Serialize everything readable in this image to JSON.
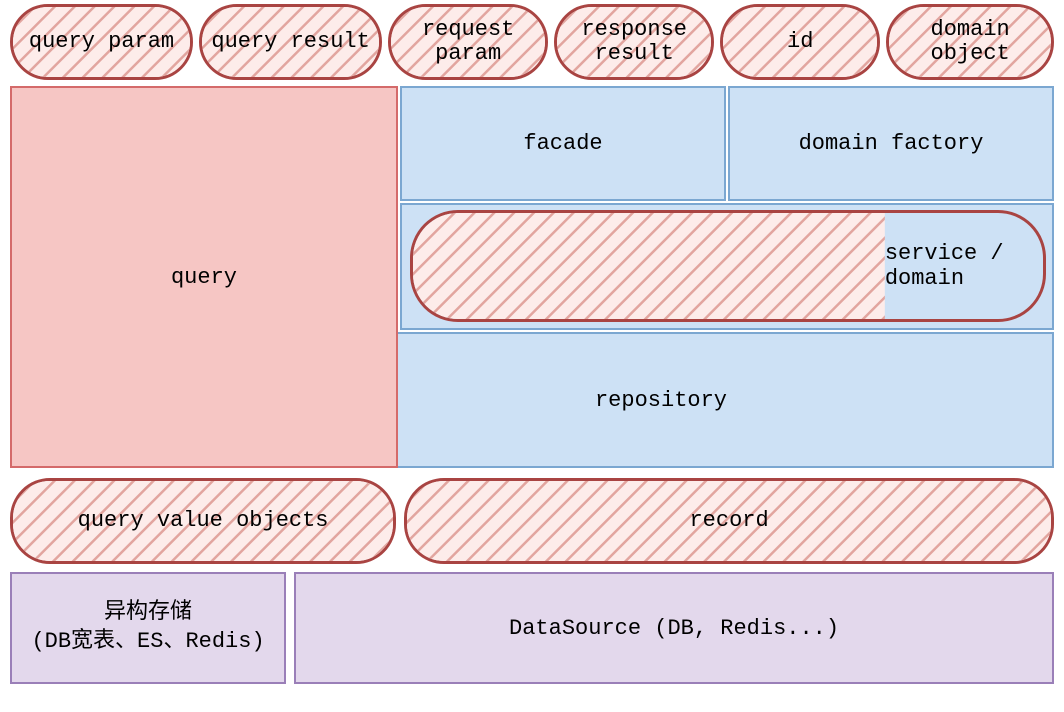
{
  "top_pills": [
    {
      "label": "query param"
    },
    {
      "label": "query result"
    },
    {
      "label": "request param"
    },
    {
      "label": "response result"
    },
    {
      "label": "id"
    },
    {
      "label": "domain object"
    }
  ],
  "blocks": {
    "query": "query",
    "facade": "facade",
    "domain_factory": "domain factory",
    "service_domain": "service / domain",
    "repository": "repository"
  },
  "bottom_pills": {
    "query_vo": "query value objects",
    "record": "record"
  },
  "datasource": {
    "hetero": "异构存储\n(DB宽表、ES、Redis)",
    "main": "DataSource (DB, Redis...)"
  }
}
